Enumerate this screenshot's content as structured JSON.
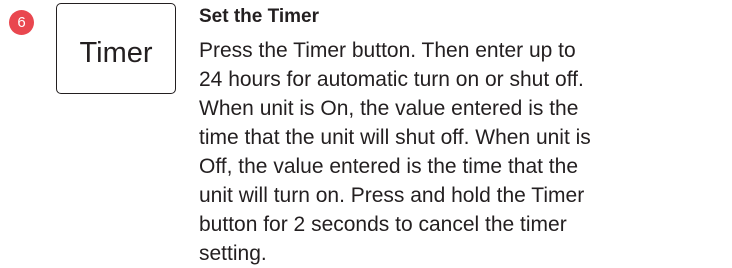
{
  "step": {
    "number": "6",
    "badge_color": "#e9474f"
  },
  "button": {
    "label": "Timer"
  },
  "section": {
    "title": "Set the Timer",
    "body": "Press the Timer button. Then enter up to\n24 hours for automatic turn on or shut off.\nWhen unit is On, the value entered is the\ntime that the unit will shut off. When unit is\nOff, the value entered is the time that the\nunit will turn on. Press and hold the Timer\nbutton for 2 seconds to cancel the timer\nsetting."
  },
  "text_color": "#231f20"
}
